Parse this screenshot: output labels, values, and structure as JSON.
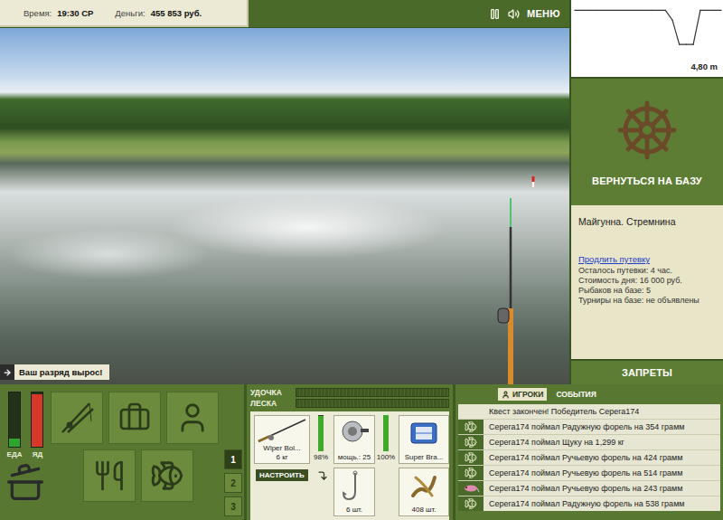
{
  "status": {
    "time_label": "Время:",
    "time": "19:30 СР",
    "money_label": "Деньги:",
    "money": "455 853 руб."
  },
  "toolbar": {
    "menu": "МЕНЮ"
  },
  "depth_chart": {
    "reading": "4,80 m",
    "profile": [
      0.6,
      0.6,
      0.6,
      0.6,
      0.6,
      0.6,
      0.6,
      0.6,
      0.6,
      0.6,
      0.6,
      0.6,
      0.6,
      0.6,
      1.8,
      4.8,
      4.8,
      4.8,
      0.6,
      0.6,
      0.6,
      0.6
    ]
  },
  "return_button": "ВЕРНУТЬСЯ НА БАЗУ",
  "location": {
    "title": "Майгунна. Стремнина",
    "extend_link": "Продлить путевку",
    "details": [
      "Осталось путевки: 4 час.",
      "Стоимость дня: 16 000 руб.",
      "Рыбаков на базе: 5",
      "Турниры на базе: не объявлены"
    ]
  },
  "bans_button": "ЗАПРЕТЫ",
  "notice": "Ваш разряд вырос!",
  "gauges": [
    {
      "label": "ЕДА",
      "level": 0.15,
      "color": "#2fa52f"
    },
    {
      "label": "ЯД",
      "level": 0.97,
      "color": "#d6392a"
    }
  ],
  "rod_sets": [
    {
      "label": "1",
      "selected": true
    },
    {
      "label": "2",
      "selected": false
    },
    {
      "label": "3",
      "selected": false
    }
  ],
  "tension": [
    {
      "label": "УДОЧКА",
      "level": 0
    },
    {
      "label": "ЛЕСКА",
      "level": 0
    }
  ],
  "tackle": {
    "rod": {
      "name": "Wiper Bol...",
      "load": "6 кг",
      "durability": "98%",
      "level": 0.98
    },
    "setup_button": "НАСТРОИТЬ",
    "reel": {
      "label": "мощь.: 25",
      "durability": "100%",
      "level": 1
    },
    "line": {
      "label": "Super Bra..."
    },
    "hook": {
      "label": "6 шт."
    },
    "bait": {
      "label": "408 шт."
    }
  },
  "log": {
    "tabs": [
      {
        "label": "ИГРОКИ",
        "selected": true
      },
      {
        "label": "СОБЫТИЯ",
        "selected": false
      }
    ],
    "entries": [
      {
        "kind": "quest",
        "text": "Квест закончен! Победитель Серега174"
      },
      {
        "kind": "catch",
        "text": "Серега174 поймал Радужную форель на 354 грамм"
      },
      {
        "kind": "catch",
        "text": "Серега174 поймал Щуку на 1,299 кг"
      },
      {
        "kind": "catch",
        "text": "Серега174 поймал Ручьевую форель на 424 грамм"
      },
      {
        "kind": "catch",
        "text": "Серега174 поймал Ручьевую форель на 514 грамм"
      },
      {
        "kind": "lure",
        "text": "Серега174 поймал Ручьевую форель на 243 грамм"
      },
      {
        "kind": "catch",
        "text": "Серега174 поймал Радужную форель на 538 грамм"
      }
    ]
  }
}
